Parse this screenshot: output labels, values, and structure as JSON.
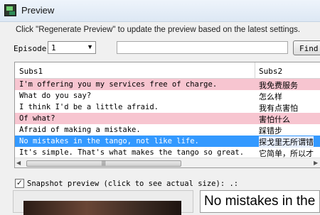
{
  "window": {
    "title": "Preview",
    "app_icon": "video-subtitle-app-icon"
  },
  "hint": "Click \"Regenerate Preview\" to update the preview based on the latest settings.",
  "episode": {
    "label": "Episode:",
    "value": "1",
    "arrow": "▼"
  },
  "find": {
    "value": "",
    "button_label": "Find"
  },
  "table": {
    "columns": [
      "Subs1",
      "Subs2"
    ],
    "rows": [
      {
        "subs1": "I'm offering you my services free of charge.",
        "subs2": "我免费服务",
        "style": "pink"
      },
      {
        "subs1": "What do you say?",
        "subs2": "怎么样",
        "style": "normal"
      },
      {
        "subs1": "I think I'd be a little afraid.",
        "subs2": "我有点害怕",
        "style": "normal"
      },
      {
        "subs1": "Of what?",
        "subs2": "害怕什么",
        "style": "pink"
      },
      {
        "subs1": "Afraid of making a mistake.",
        "subs2": "踩错步",
        "style": "normal"
      },
      {
        "subs1": "No mistakes in the tango, not like life.",
        "subs2": "探戈里无所谓错",
        "style": "selected"
      },
      {
        "subs1": "It's simple. That's what makes the tango so great.",
        "subs2": "它简单，所以才",
        "style": "normal"
      }
    ]
  },
  "scrollbar": {
    "left_arrow": "◀",
    "right_arrow": "▶",
    "grip": "|||"
  },
  "snapshot": {
    "checked": true,
    "check_glyph": "✓",
    "label": "Snapshot preview (click to see actual size): .:"
  },
  "caption": {
    "text": "No mistakes in the tango, not like life."
  },
  "colors": {
    "pink_row": "#f7c5d0",
    "selected_row": "#3399ff"
  }
}
